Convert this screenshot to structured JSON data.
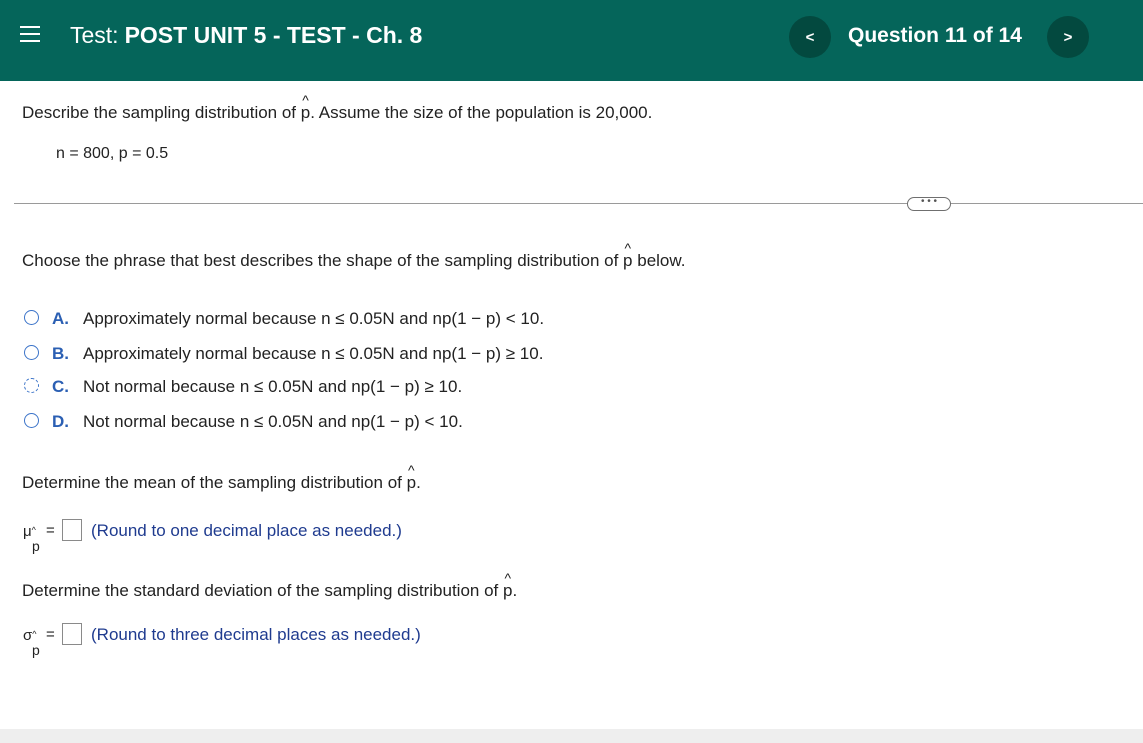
{
  "header": {
    "title_prefix": "Test:",
    "title": "POST UNIT 5 - TEST - Ch. 8",
    "question_counter": "Question 11 of 14",
    "prev_symbol": "<",
    "next_symbol": ">"
  },
  "problem": {
    "prompt_before": "Describe the sampling distribution of",
    "phat": "p",
    "prompt_after": ". Assume the size of the population is 20,000.",
    "given": "n = 800, p = 0.5",
    "more_label": "• • •"
  },
  "part1": {
    "prompt_before": "Choose the phrase that best describes the shape of the sampling distribution of",
    "phat": "p",
    "prompt_after": " below.",
    "options": [
      {
        "letter": "A.",
        "text": "Approximately normal because n ≤ 0.05N and np(1 − p) < 10."
      },
      {
        "letter": "B.",
        "text": "Approximately normal because n ≤ 0.05N and np(1 − p) ≥ 10."
      },
      {
        "letter": "C.",
        "text": "Not normal because n ≤ 0.05N and np(1 − p) ≥ 10."
      },
      {
        "letter": "D.",
        "text": "Not normal because n ≤ 0.05N and np(1 − p) < 10."
      }
    ]
  },
  "part2": {
    "prompt_before": "Determine the mean of the sampling distribution of",
    "phat": "p",
    "prompt_after": ".",
    "symbol": "μ",
    "subscript": "p",
    "equals": "=",
    "hint": "(Round to one decimal place as needed.)"
  },
  "part3": {
    "prompt_before": "Determine the standard deviation of the sampling distribution of",
    "phat": "p",
    "prompt_after": ".",
    "symbol": "σ",
    "subscript": "p",
    "equals": "=",
    "hint": "(Round to three decimal places as needed.)"
  },
  "colors": {
    "header_bg": "#05655a",
    "nav_button_bg": "#03493f",
    "option_letter": "#2b5fb3",
    "hint_text": "#1f3b8f"
  }
}
